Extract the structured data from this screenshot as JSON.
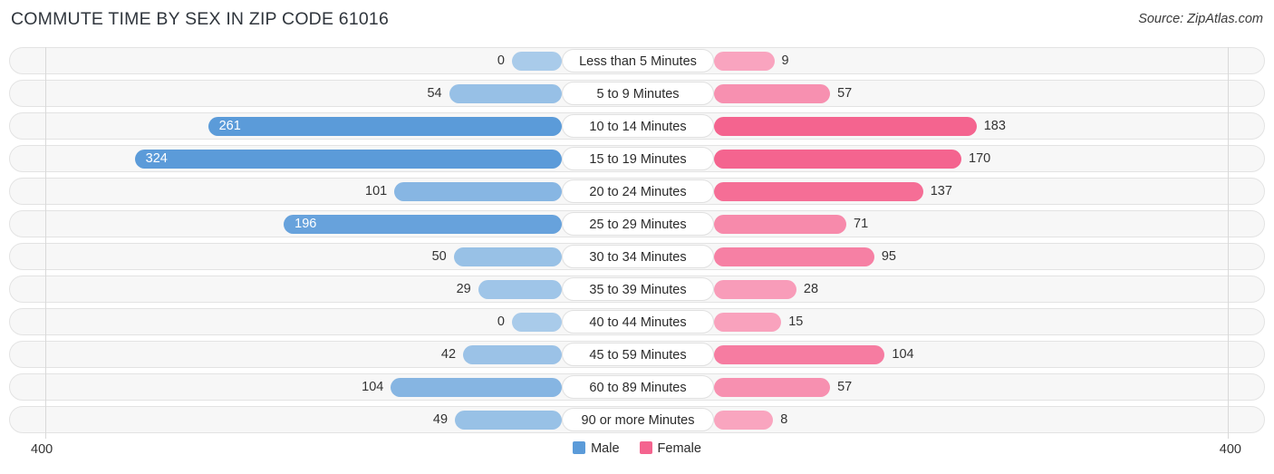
{
  "header": {
    "title": "COMMUTE TIME BY SEX IN ZIP CODE 61016",
    "source": "Source: ZipAtlas.com"
  },
  "axis": {
    "left_label": "400",
    "right_label": "400",
    "max": 400
  },
  "legend": {
    "items": [
      {
        "label": "Male",
        "color": "#5b9bd9"
      },
      {
        "label": "Female",
        "color": "#f4648f"
      }
    ]
  },
  "chart_data": {
    "type": "bar",
    "title": "COMMUTE TIME BY SEX IN ZIP CODE 61016",
    "subtitle": "Source: ZipAtlas.com",
    "orientation": "horizontal-diverging",
    "xlabel": "",
    "ylabel": "",
    "xlim": [
      400,
      400
    ],
    "grid": false,
    "legend_position": "bottom-center",
    "categories": [
      "Less than 5 Minutes",
      "5 to 9 Minutes",
      "10 to 14 Minutes",
      "15 to 19 Minutes",
      "20 to 24 Minutes",
      "25 to 29 Minutes",
      "30 to 34 Minutes",
      "35 to 39 Minutes",
      "40 to 44 Minutes",
      "45 to 59 Minutes",
      "60 to 89 Minutes",
      "90 or more Minutes"
    ],
    "series": [
      {
        "name": "Male",
        "color": "#5b9bd9",
        "direction": "left",
        "values": [
          0,
          54,
          261,
          324,
          101,
          196,
          50,
          29,
          0,
          42,
          104,
          49
        ]
      },
      {
        "name": "Female",
        "color": "#f4648f",
        "direction": "right",
        "values": [
          9,
          57,
          183,
          170,
          137,
          71,
          95,
          28,
          15,
          104,
          57,
          8
        ]
      }
    ]
  },
  "rows": [
    {
      "label": "Less than 5 Minutes",
      "male": "0",
      "female": "9"
    },
    {
      "label": "5 to 9 Minutes",
      "male": "54",
      "female": "57"
    },
    {
      "label": "10 to 14 Minutes",
      "male": "261",
      "female": "183"
    },
    {
      "label": "15 to 19 Minutes",
      "male": "324",
      "female": "170"
    },
    {
      "label": "20 to 24 Minutes",
      "male": "101",
      "female": "137"
    },
    {
      "label": "25 to 29 Minutes",
      "male": "196",
      "female": "71"
    },
    {
      "label": "30 to 34 Minutes",
      "male": "50",
      "female": "95"
    },
    {
      "label": "35 to 39 Minutes",
      "male": "29",
      "female": "28"
    },
    {
      "label": "40 to 44 Minutes",
      "male": "0",
      "female": "15"
    },
    {
      "label": "45 to 59 Minutes",
      "male": "42",
      "female": "104"
    },
    {
      "label": "60 to 89 Minutes",
      "male": "104",
      "female": "57"
    },
    {
      "label": "90 or more Minutes",
      "male": "49",
      "female": "8"
    }
  ]
}
